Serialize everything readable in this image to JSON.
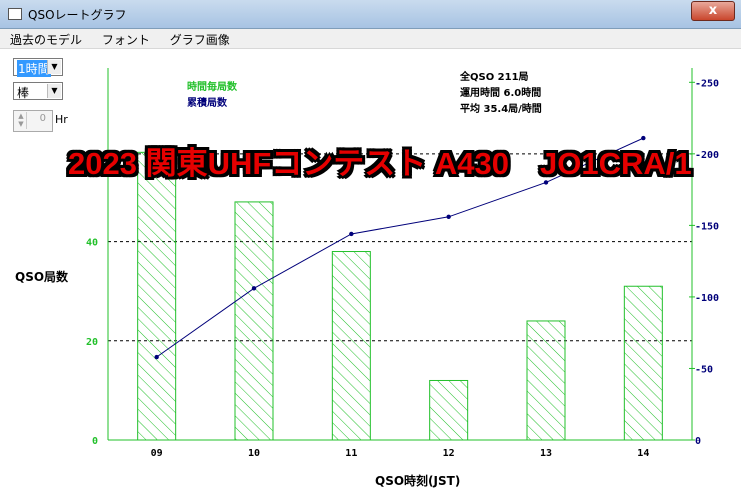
{
  "window": {
    "title": "QSOレートグラフ",
    "close_label": "x"
  },
  "menu": [
    "過去のモデル",
    "フォント",
    "グラフ画像"
  ],
  "controls": {
    "interval": "1時間",
    "style": "棒",
    "spin_value": "0",
    "spin_unit": "Hr"
  },
  "legend": {
    "hourly": "時間毎局数",
    "cumulative": "累積局数"
  },
  "stats": [
    "全QSO 211局",
    "運用時間 6.0時間",
    "平均 35.4局/時間"
  ],
  "overlay_text": "2023 関東UHFコンテスト A430　JO1CRA/1",
  "colors": {
    "bar": "#22c02a",
    "line": "#00007a",
    "overlay": "#e60000"
  },
  "chart_data": {
    "type": "bar",
    "categories": [
      "09",
      "10",
      "11",
      "12",
      "13",
      "14"
    ],
    "values": [
      58,
      48,
      38,
      12,
      24,
      31
    ],
    "cumulative": [
      58,
      106,
      144,
      156,
      180,
      211
    ],
    "ylabel": "QSO局数",
    "xlabel": "QSO時刻(JST)",
    "ylim": [
      0,
      75
    ],
    "y2lim": [
      0,
      260
    ],
    "left_ticks": [
      0,
      20,
      40
    ],
    "right_ticks": [
      0,
      50,
      100,
      150,
      200,
      250
    ],
    "right_tick_labels": [
      "0",
      "-50",
      "-100",
      "-150",
      "-200",
      "-250"
    ]
  }
}
